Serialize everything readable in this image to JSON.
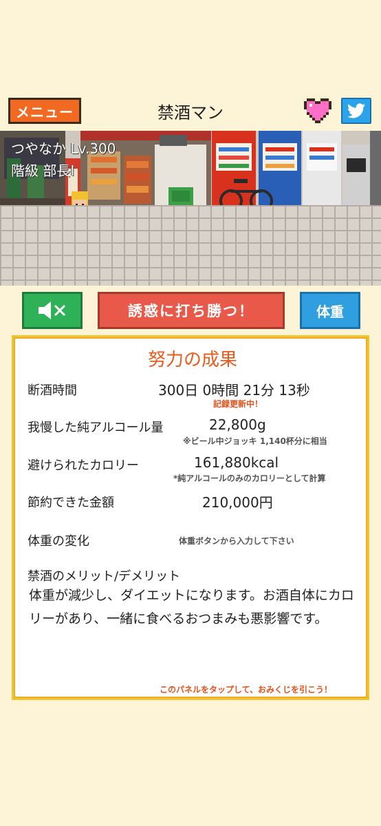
{
  "header": {
    "menu_label": "メニュー",
    "title": "禁酒マン"
  },
  "player": {
    "name": "つやなか Lv.300",
    "rank": "階級 部長Ⅰ"
  },
  "buttons": {
    "resist_label": "誘惑に打ち勝つ！",
    "weight_label": "体重"
  },
  "panel": {
    "title": "努力の成果",
    "abstinence_label": "断酒時間",
    "abstinence_value": "300日 0時間 21分 13秒",
    "record_note": "記録更新中！",
    "alcohol_label": "我慢した純アルコール量",
    "alcohol_value": "22,800g",
    "alcohol_note": "※ビール中ジョッキ 1,140杯分に相当",
    "calorie_label": "避けられたカロリー",
    "calorie_value": "161,880kcal",
    "calorie_note": "*純アルコールのみのカロリーとして計算",
    "money_label": "節約できた金額",
    "money_value": "210,000円",
    "weight_label": "体重の変化",
    "weight_note": "体重ボタンから入力して下さい",
    "merit_label": "禁酒のメリット/デメリット",
    "merit_text": "体重が減少し、ダイエットになります。お酒自体にカロリーがあり、一緒に食べるおつまみも悪影響です。",
    "footer_note": "このパネルをタップして、おみくじを引こう！"
  },
  "colors": {
    "menu": "#f26a22",
    "resist": "#e9594a",
    "mute": "#2fb257",
    "weight": "#2f9fe0",
    "panel_border": "#f2c230",
    "accent_text": "#ea5a1c"
  }
}
